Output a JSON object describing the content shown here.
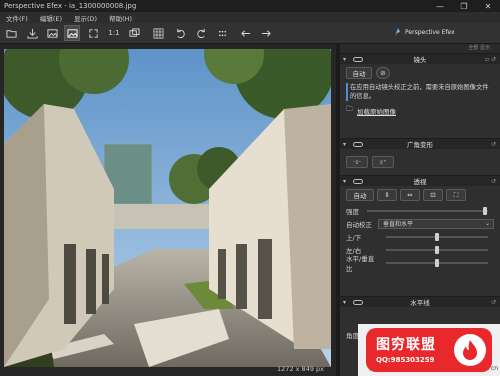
{
  "window": {
    "title": "Perspective Efex - ia_1300000008.jpg",
    "minimize": "—",
    "maximize": "❐",
    "close": "✕"
  },
  "menu": {
    "items": [
      "文件(F)",
      "编辑(E)",
      "显示(D)",
      "帮助(H)"
    ]
  },
  "toolbar": {
    "zoom_label": "1:1",
    "brand": "Perspective Efex"
  },
  "canvas": {
    "dimensions": "1272 x 849 px"
  },
  "panel": {
    "top_hint": "全部 显示",
    "lens": {
      "title": "镜头",
      "auto_label": "自动",
      "note": "在应用自动镜头校正之前，需要未自原始图像文件的信息。",
      "load_link": "加载原始图像"
    },
    "wide_angle": {
      "title": "广角变形"
    },
    "perspective": {
      "title": "透视",
      "auto_label": "自动",
      "strength_label": "强度",
      "auto_correct_label": "自动校正",
      "auto_correct_value": "垂直和水平",
      "up_down_label": "上/下",
      "left_right_label": "左/右",
      "ratio_label": "水平/垂直比"
    },
    "horizon": {
      "title": "水平线",
      "angle_label": "角度"
    }
  },
  "watermark": {
    "title": "图穷联盟",
    "qq": "QQ:985303259",
    "site": "cn"
  },
  "colors": {
    "accent": "#4a90d9",
    "panel": "#2f2f2f",
    "logo_red": "#e8282b"
  }
}
